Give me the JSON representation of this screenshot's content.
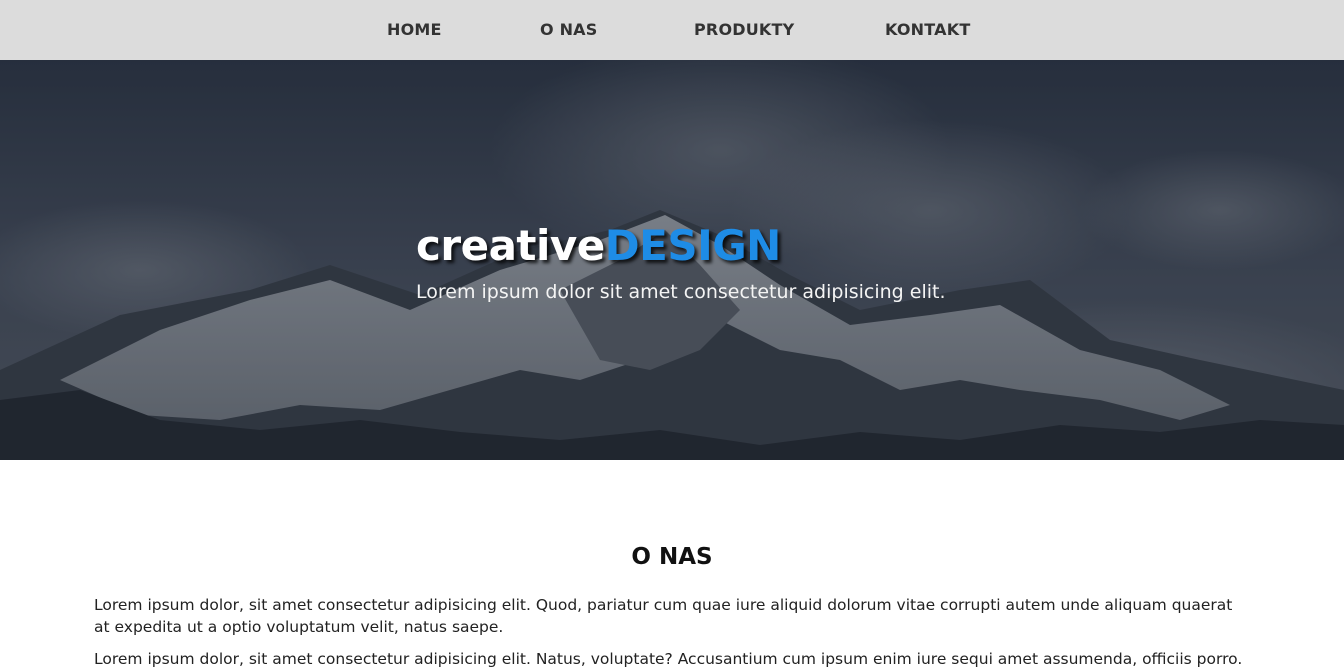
{
  "nav": {
    "items": [
      {
        "label": "HOME"
      },
      {
        "label": "O NAS"
      },
      {
        "label": "PRODUKTY"
      },
      {
        "label": "KONTAKT"
      }
    ]
  },
  "hero": {
    "title_white": "creative",
    "title_blue": "DESIGN",
    "subtitle": "Lorem ipsum dolor sit amet consectetur adipisicing elit.",
    "background": "mountain-photo"
  },
  "about": {
    "heading": "O NAS",
    "paragraphs": [
      "Lorem ipsum dolor, sit amet consectetur adipisicing elit. Quod, pariatur cum quae iure aliquid dolorum vitae corrupti autem unde aliquam quaerat at expedita ut a optio voluptatum velit, natus saepe.",
      "Lorem ipsum dolor, sit amet consectetur adipisicing elit. Natus, voluptate? Accusantium cum ipsum enim iure sequi amet assumenda, officiis porro."
    ]
  },
  "colors": {
    "nav_bg": "#dcdcdc",
    "nav_text": "#333333",
    "accent": "#1e8ce6",
    "hero_overlay": "#1e2430"
  }
}
